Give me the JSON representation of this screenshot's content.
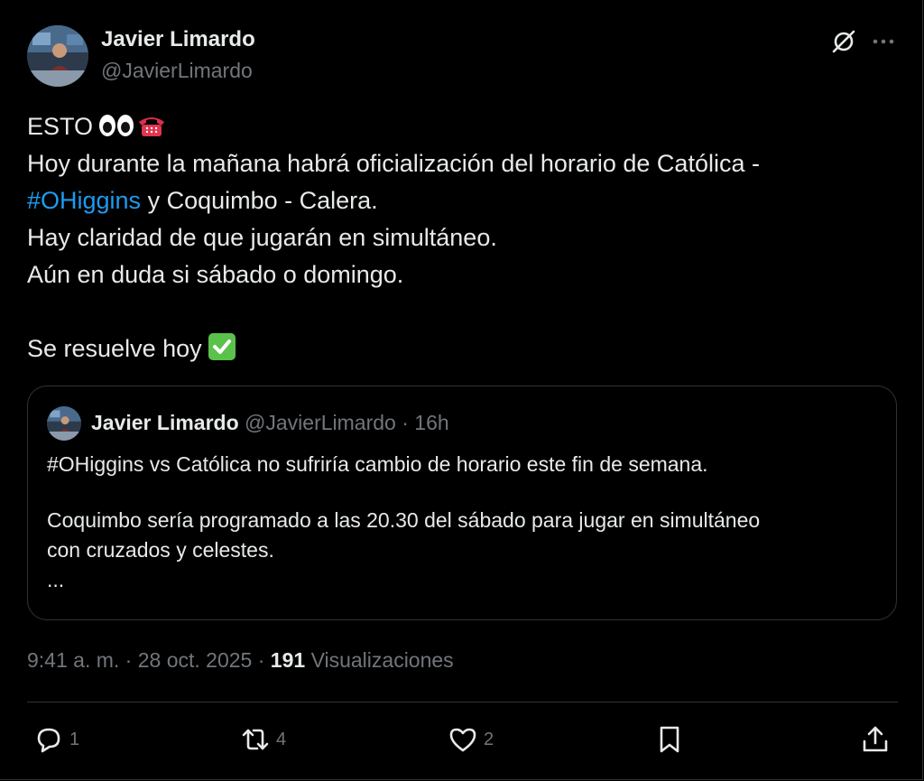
{
  "author": {
    "name": "Javier Limardo",
    "handle": "@JavierLimardo"
  },
  "header_icons": [
    "grok-icon",
    "more-icon"
  ],
  "tweet": {
    "lines": [
      "ESTO",
      "Hoy durante la mañana habrá oficialización del horario de Católica -",
      "#OHiggins",
      " y Coquimbo - Calera.",
      "Hay claridad de que jugarán en simultáneo.",
      "Aún en duda si sábado o domingo.",
      "Se resuelve hoy"
    ],
    "emojis": [
      "eyes-emoji",
      "telephone-emoji",
      "check-mark-emoji"
    ]
  },
  "quote": {
    "name": "Javier Limardo",
    "handle": "@JavierLimardo",
    "separator": "·",
    "time": "16h",
    "lines": [
      "#OHiggins vs Católica no sufriría cambio de horario este fin de semana.",
      "Coquimbo sería programado a las 20.30 del sábado para jugar en simultáneo",
      "con cruzados y celestes.",
      "..."
    ]
  },
  "meta": {
    "time": "9:41 a. m.",
    "separator": "·",
    "date": "28 oct. 2025",
    "views_count": "191",
    "views_label": "Visualizaciones"
  },
  "actions": {
    "replies": "1",
    "reposts": "4",
    "likes": "2"
  },
  "colors": {
    "background": "#000000",
    "text": "#e7e9ea",
    "secondary": "#71767b",
    "link": "#1d9bf0",
    "border": "#2f3336"
  }
}
